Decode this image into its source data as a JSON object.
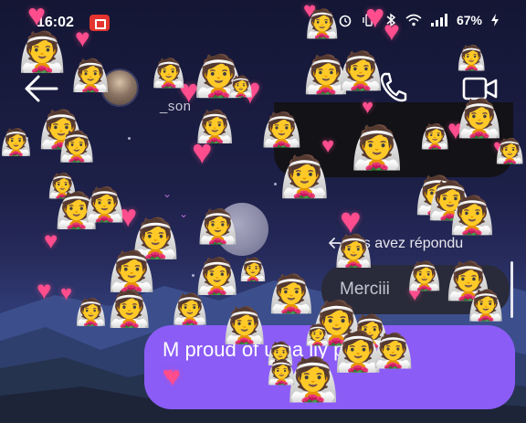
{
  "status_bar": {
    "time": "16:02",
    "battery": "67%",
    "icons": [
      "alarm-icon",
      "vibrate-icon",
      "bluetooth-icon",
      "wifi-icon",
      "signal-icon",
      "battery-icon"
    ]
  },
  "header": {
    "contact_name": "_son",
    "icons": [
      "back-arrow-icon",
      "phone-icon",
      "video-call-icon"
    ]
  },
  "messages": {
    "reply_label": "ous avez répondu",
    "incoming_text": "Merciii",
    "outgoing_text": "M proud of u ha          lly proud",
    "outgoing_heart": "♥"
  },
  "effects": {
    "heart_glyph": "♥",
    "bride_glyph": "👰"
  },
  "colors": {
    "accent_bubble": "#8b5cf6",
    "heart": "#ff4d8d",
    "incoming_bubble": "#2a2b3a",
    "record_badge": "#e3342f"
  }
}
